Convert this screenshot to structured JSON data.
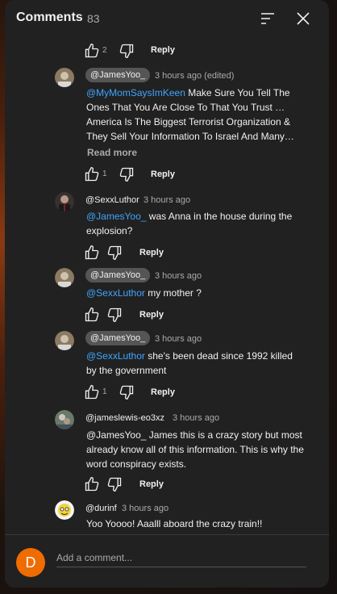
{
  "header": {
    "title": "Comments",
    "count": "83"
  },
  "comments": [
    {
      "likes": "2",
      "reply": "Reply"
    },
    {
      "author": "@JamesYoo_",
      "time": "3 hours ago (edited)",
      "mention": "@MyMomSaysImKeen",
      "text": " Make Sure You Tell The Ones That You Are Close To That You Trust … America Is The Biggest Terrorist Organization & They Sell Your Information To Israel And Many…",
      "read_more": "Read more",
      "likes": "1",
      "reply": "Reply"
    },
    {
      "author": "@SexxLuthor",
      "time": "3 hours ago",
      "mention": "@JamesYoo_",
      "text": " was Anna in the house during the explosion?",
      "likes": "",
      "reply": "Reply"
    },
    {
      "author": "@JamesYoo_",
      "time": "3 hours ago",
      "mention": "@SexxLuthor",
      "text": " my mother ?",
      "likes": "",
      "reply": "Reply"
    },
    {
      "author": "@JamesYoo_",
      "time": "3 hours ago",
      "mention": "@SexxLuthor",
      "text": " she's been dead since 1992 killed by the government",
      "likes": "1",
      "reply": "Reply"
    },
    {
      "author": "@jameslewis-eo3xz",
      "time": "3 hours ago",
      "text": "@JamesYoo_  James this is a crazy story but most already know all of this information. This is why the word conspiracy exists.",
      "likes": "",
      "reply": "Reply"
    },
    {
      "author": "@durinf",
      "time": "3 hours ago",
      "text": "Yoo Yoooo! Aaalll aboard the crazy train!!"
    }
  ],
  "footer": {
    "avatar_letter": "D",
    "placeholder": "Add a comment..."
  },
  "colors": {
    "mention": "#3ea6ff",
    "panel": "#212121",
    "avatar": "#ef6c00"
  }
}
